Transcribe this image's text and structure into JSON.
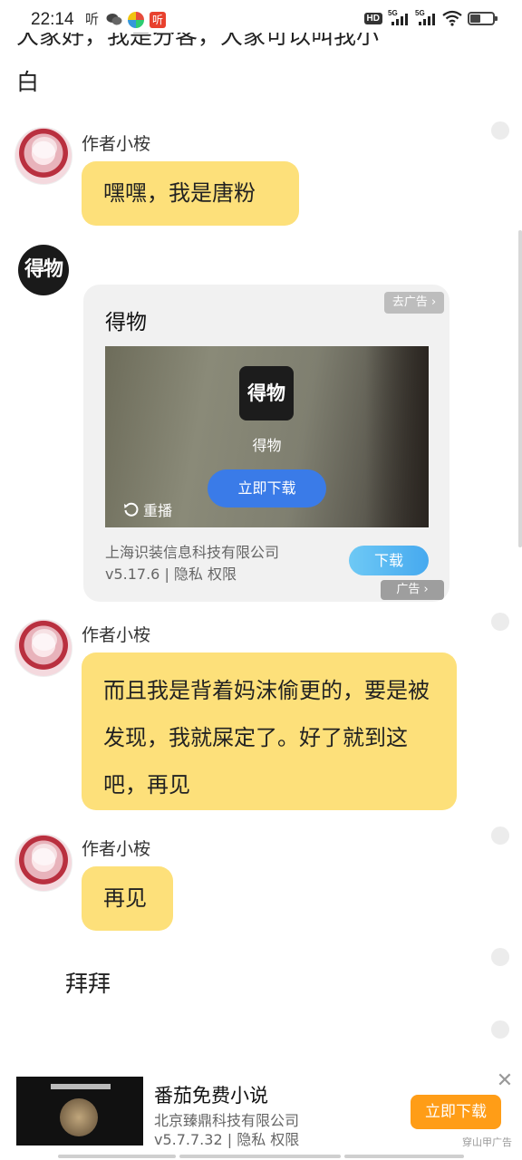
{
  "status_bar": {
    "time": "22:14",
    "app_glyph_listen": "听",
    "app_glyph_red": "听",
    "hd_label": "HD",
    "signal1": "5G",
    "signal2": "5G"
  },
  "prev_message": {
    "fragment": "大家好，我是分客，大家可以叫我小",
    "end": "白"
  },
  "messages": [
    {
      "author": "作者小桉",
      "text": "嘿嘿，我是唐粉"
    },
    {
      "author": "作者小桉",
      "text": "而且我是背着妈沫偷更的，要是被发现，我就屎定了。好了就到这吧，再见"
    },
    {
      "author": "作者小桉",
      "text": "再见"
    }
  ],
  "ad_card": {
    "logo_text": "得物",
    "title": "得物",
    "remove_label": "去广告 ›",
    "video_logo_text": "得物",
    "video_app_name": "得物",
    "video_download": "立即下载",
    "replay": "重播",
    "company": "上海识装信息科技有限公司",
    "version_line": "v5.17.6 | 隐私  权限",
    "download": "下载",
    "badge": "广告 ›"
  },
  "plain_message": "拜拜",
  "bottom_ad": {
    "title": "番茄免费小说",
    "company": "北京臻鼎科技有限公司",
    "version_line": "v5.7.7.32 | 隐私  权限",
    "download": "立即下载",
    "source": "穿山甲广告",
    "close": "✕"
  },
  "colors": {
    "bubble": "#fde07a",
    "ad_download_blue": "#46a9ef",
    "bottom_download_orange": "#ff9d17"
  }
}
